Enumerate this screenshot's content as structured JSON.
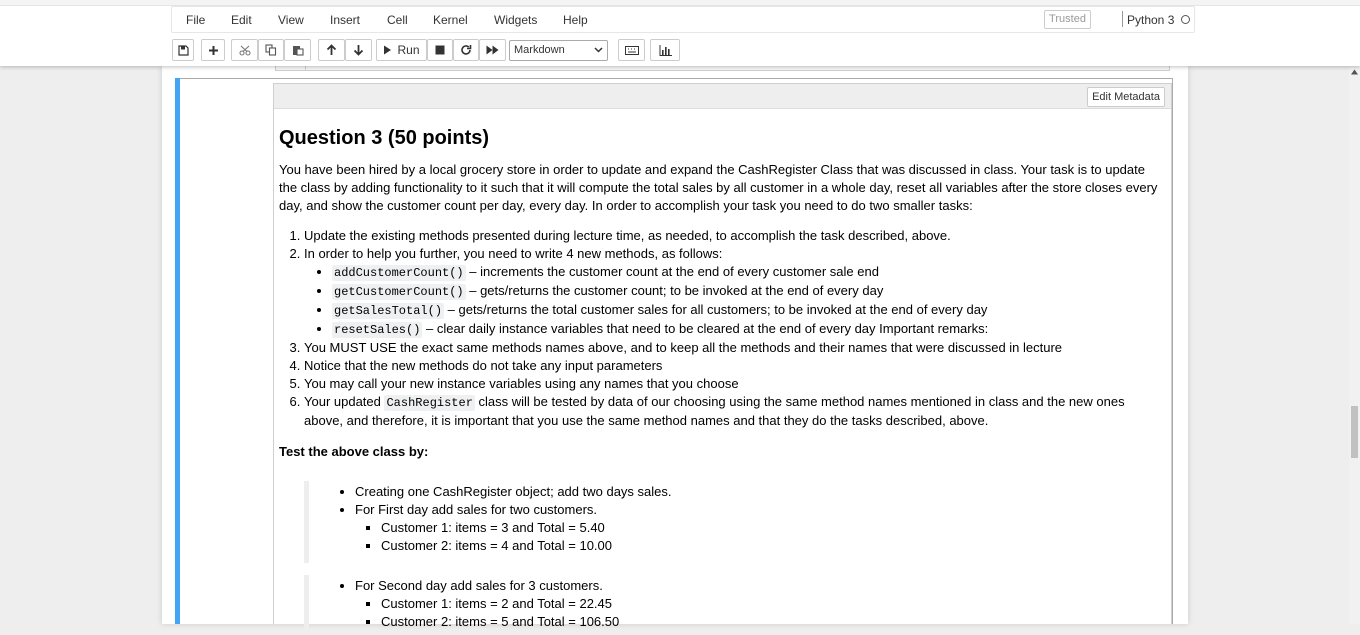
{
  "menubar": {
    "items": [
      "File",
      "Edit",
      "View",
      "Insert",
      "Cell",
      "Kernel",
      "Widgets",
      "Help"
    ],
    "trusted": "Trusted",
    "kernel": "Python 3"
  },
  "toolbar": {
    "run_label": "Run",
    "cell_type": "Markdown"
  },
  "cell": {
    "edit_metadata_label": "Edit Metadata",
    "heading": "Question 3 (50 points)",
    "intro": "You have been hired by a local grocery store in order to update and expand the CashRegister Class that was discussed in class. Your task is to update the class by adding functionality to it such that it will compute the total sales by all customer in a whole day, reset all variables after the store closes every day, and show the customer count per day, every day. In order to accomplish your task you need to do two smaller tasks:",
    "step1": "Update the existing methods presented during lecture time, as needed, to accomplish the task described, above.",
    "step2": "In order to help you further, you need to write 4 new methods, as follows:",
    "methods": [
      {
        "code": "addCustomerCount()",
        "desc": " – increments the customer count at the end of every customer sale end"
      },
      {
        "code": "getCustomerCount()",
        "desc": " – gets/returns the customer count; to be invoked at the end of every day"
      },
      {
        "code": "getSalesTotal()",
        "desc": " – gets/returns the total customer sales for all customers; to be invoked at the end of every day"
      },
      {
        "code": "resetSales()",
        "desc": " – clear daily instance variables that need to be cleared at the end of every day Important remarks:"
      }
    ],
    "step3": "You MUST USE the exact same methods names above, and to keep all the methods and their names that were discussed in lecture",
    "step4": "Notice that the new methods do not take any input parameters",
    "step5": "You may call your new instance variables using any names that you choose",
    "step6_pre": "Your updated ",
    "step6_code": "CashRegister",
    "step6_post": " class will be tested by data of our choosing using the same method names mentioned in class and the new ones above, and therefore, it is important that you use the same method names and that they do the tasks described, above.",
    "test_heading": "Test the above class by:",
    "day1": {
      "item1": "Creating one CashRegister object; add two days sales.",
      "item2": "For First day add sales for two customers.",
      "customers": [
        "Customer 1: items = 3 and Total = 5.40",
        "Customer 2: items = 4 and Total = 10.00"
      ]
    },
    "day2": {
      "item1": "For Second day add sales for 3 customers.",
      "customers": [
        "Customer 1: items = 2 and Total = 22.45",
        "Customer 2: items = 5 and Total = 106.50"
      ]
    }
  },
  "colors": {
    "selected_bar": "#42a5f5",
    "page_bg": "#eeeeee"
  }
}
